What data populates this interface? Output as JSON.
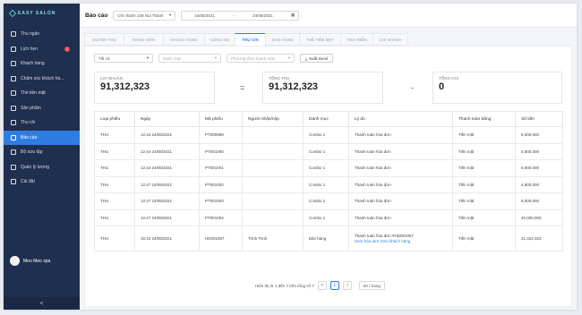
{
  "app": {
    "logo_text": "EASY SALON"
  },
  "sidebar": {
    "items": [
      {
        "label": "Thu ngân",
        "icon": "cashier-icon"
      },
      {
        "label": "Lịch hẹn",
        "icon": "calendar-icon",
        "badge": "1"
      },
      {
        "label": "Khách hàng",
        "icon": "users-icon"
      },
      {
        "label": "Chăm sóc khách hà...",
        "icon": "care-icon"
      },
      {
        "label": "Thẻ tiền mặt",
        "icon": "card-icon"
      },
      {
        "label": "Sản phẩm",
        "icon": "product-icon"
      },
      {
        "label": "Thu chi",
        "icon": "wallet-icon"
      },
      {
        "label": "Báo cáo",
        "icon": "chart-icon",
        "active": true
      },
      {
        "label": "Bộ sưu tập",
        "icon": "collection-icon"
      },
      {
        "label": "Quản lý lương",
        "icon": "salary-icon"
      },
      {
        "label": "Cài đặt",
        "icon": "gear-icon"
      }
    ],
    "user_name": "Meo Meo spa",
    "collapse_glyph": "<"
  },
  "topbar": {
    "title": "Báo cáo",
    "branch": "Chi nhánh 108 Núi Thành",
    "date_from": "24/08/2021",
    "date_sep": "-",
    "date_to": "24/08/2021"
  },
  "tabs": [
    "Doanh thu",
    "Nhân viên",
    "Khách hàng",
    "Công nợ",
    "Thu chi",
    "Kho hàng",
    "Thẻ tiền mặt",
    "Tích điểm",
    "Chi nhánh"
  ],
  "active_tab": "Thu chi",
  "filters": {
    "type": "Tất cả",
    "category_placeholder": "Danh mục",
    "payment_placeholder": "Phương thức thanh toán",
    "export_label": "Xuất excel"
  },
  "stats": {
    "profit_label": "Lợi nhuận",
    "profit_value": "91,312,323",
    "equals": "=",
    "income_label": "Tổng thu",
    "income_value": "91,312,323",
    "minus": "-",
    "expense_label": "Tổng chi",
    "expense_value": "0"
  },
  "table": {
    "headers": [
      "Loại phiếu",
      "Ngày",
      "Mã phiếu",
      "Người nhận/nộp",
      "Danh mục",
      "Lý do",
      "Thanh toán bằng",
      "Số tiền"
    ],
    "rows": [
      [
        "THU",
        "12:44 24/08/2021",
        "PT000999",
        "",
        "Combo 1",
        "Thanh toán hóa đơn",
        "Tiền mặt",
        "5,000,000"
      ],
      [
        "THU",
        "12:44 24/08/2021",
        "PT001000",
        "",
        "Combo 1",
        "Thanh toán hóa đơn",
        "Tiền mặt",
        "5,000,000"
      ],
      [
        "THU",
        "12:44 24/08/2021",
        "PT001001",
        "",
        "Combo 1",
        "Thanh toán hóa đơn",
        "Tiền mặt",
        "5,000,000"
      ],
      [
        "THU",
        "12:47 24/08/2021",
        "PT001002",
        "",
        "Combo 1",
        "Thanh toán hóa đơn",
        "Tiền mặt",
        "4,500,000"
      ],
      [
        "THU",
        "12:47 24/08/2021",
        "PT001003",
        "",
        "Combo 1",
        "Thanh toán hóa đơn",
        "Tiền mặt",
        "8,000,000"
      ],
      [
        "THU",
        "12:47 24/08/2021",
        "PT001004",
        "",
        "Combo 1",
        "Thanh toán hóa đơn",
        "Tiền mặt",
        "40,000,000"
      ],
      [
        "THU",
        "15:10 24/08/2021",
        "HD001067",
        "Trinh Trinh",
        "Bán hàng",
        "Thanh toán hóa đơn #HD001067",
        "Tiền mặt",
        "21,312,323"
      ]
    ],
    "row7_link": "Xem hóa đơn  Xem khách hàng"
  },
  "pagination": {
    "summary": "Hiển thị từ 1 đến 7 trên tổng số 7",
    "prev": "<",
    "current": "1",
    "next": ">",
    "page_size": "50 / trang"
  },
  "colors": {
    "sidebar": "#1f2f4f",
    "accent": "#2f7de1",
    "badge": "#e5484d"
  }
}
